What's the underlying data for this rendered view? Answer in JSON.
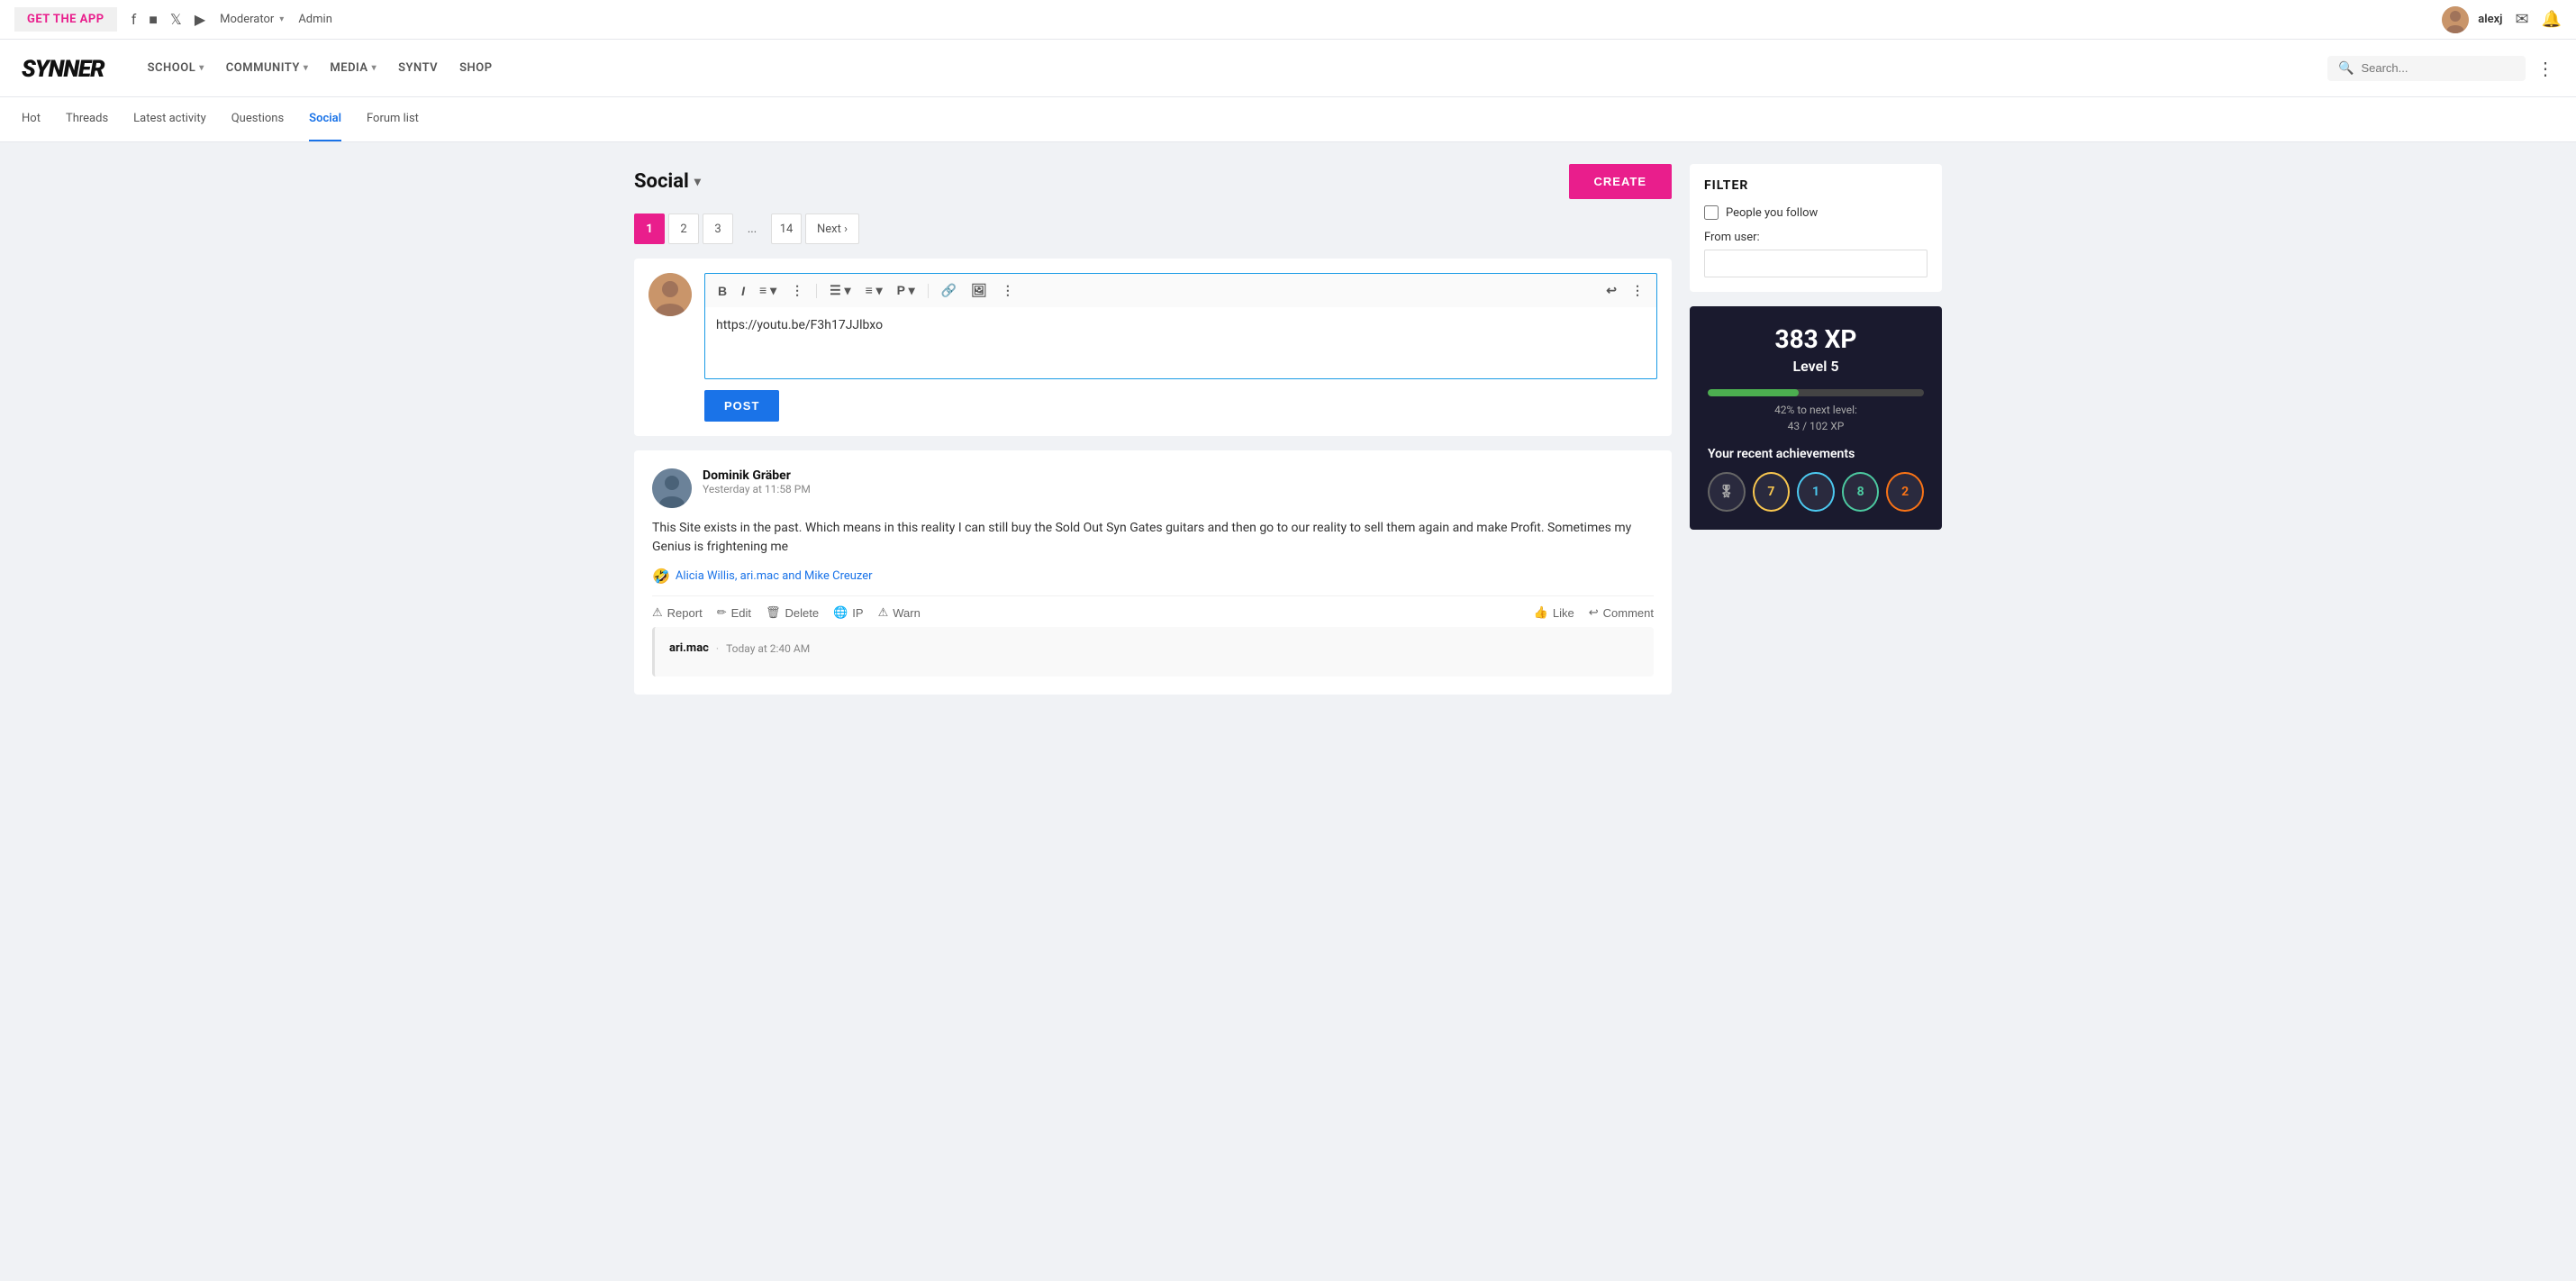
{
  "topbar": {
    "get_app_label": "GET THE APP",
    "social_icons": [
      "facebook",
      "instagram",
      "twitter",
      "youtube"
    ],
    "moderator_label": "Moderator",
    "admin_label": "Admin",
    "user_name": "alexj"
  },
  "mainnav": {
    "logo": "SYNNER",
    "items": [
      {
        "label": "SCHOOL",
        "has_dropdown": true
      },
      {
        "label": "COMMUNITY",
        "has_dropdown": true
      },
      {
        "label": "MEDIA",
        "has_dropdown": true
      },
      {
        "label": "SYNTV",
        "has_dropdown": false
      },
      {
        "label": "SHOP",
        "has_dropdown": false
      }
    ],
    "search_placeholder": "Search...",
    "more_icon": "⋮"
  },
  "subnav": {
    "items": [
      {
        "label": "Hot",
        "active": false
      },
      {
        "label": "Threads",
        "active": false
      },
      {
        "label": "Latest activity",
        "active": false
      },
      {
        "label": "Questions",
        "active": false
      },
      {
        "label": "Social",
        "active": true
      },
      {
        "label": "Forum list",
        "active": false
      }
    ]
  },
  "page": {
    "title": "Social",
    "create_label": "CREATE"
  },
  "pagination": {
    "pages": [
      "1",
      "2",
      "3"
    ],
    "dots": "...",
    "last_page": "14",
    "next_label": "Next ›"
  },
  "editor": {
    "content": "https://youtu.be/F3h17JJlbxo",
    "post_label": "POST",
    "toolbar": {
      "bold": "B",
      "italic": "I",
      "align": "≡",
      "dots1": "⋮",
      "list": "☰",
      "align2": "≡",
      "paragraph": "P",
      "link": "🔗",
      "image": "🖼",
      "dots2": "⋮",
      "undo": "↩",
      "dots3": "⋮"
    }
  },
  "posts": [
    {
      "author": "Dominik Gräber",
      "time": "Yesterday at 11:58 PM",
      "body": "This Site exists in the past. Which means in this reality I can still buy the Sold Out Syn Gates guitars and then go to our reality to sell them again and make Profit. Sometimes my Genius is frightening me",
      "reactions_emoji": "🤣",
      "reactions_names": "Alicia Willis, ari.mac and Mike Creuzer",
      "actions_left": [
        {
          "label": "Report",
          "icon": "⚠"
        },
        {
          "label": "Edit",
          "icon": "✏"
        },
        {
          "label": "Delete",
          "icon": "🗑"
        },
        {
          "label": "IP",
          "icon": "🌐"
        },
        {
          "label": "Warn",
          "icon": "⚠"
        }
      ],
      "actions_right": [
        {
          "label": "Like",
          "icon": "👍"
        },
        {
          "label": "Comment",
          "icon": "↩"
        }
      ]
    }
  ],
  "reply": {
    "author": "ari.mac",
    "time_prefix": "Today at 2:40 AM"
  },
  "filter": {
    "title": "FILTER",
    "people_you_follow_label": "People you follow",
    "from_user_label": "From user:",
    "from_user_placeholder": ""
  },
  "xp": {
    "amount": "383 XP",
    "level": "Level 5",
    "percent": "42% to next level:",
    "values": "43 / 102 XP",
    "bar_fill_percent": 42,
    "achievements_title": "Your recent achievements",
    "badges": [
      {
        "label": "🎖",
        "type": "gray"
      },
      {
        "label": "7",
        "type": "yellow"
      },
      {
        "label": "1",
        "type": "blue"
      },
      {
        "label": "8",
        "type": "teal"
      },
      {
        "label": "2",
        "type": "orange"
      }
    ]
  }
}
